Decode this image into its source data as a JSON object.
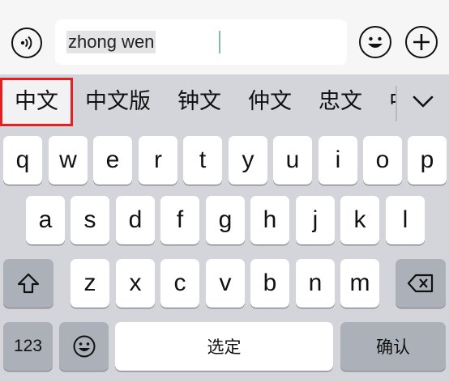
{
  "input": {
    "text": "zhong wen"
  },
  "candidates": [
    {
      "text": "中文",
      "selected": true
    },
    {
      "text": "中文版"
    },
    {
      "text": "钟文"
    },
    {
      "text": "仲文"
    },
    {
      "text": "忠文"
    },
    {
      "text": "中"
    }
  ],
  "keyboard": {
    "row1": [
      "q",
      "w",
      "e",
      "r",
      "t",
      "y",
      "u",
      "i",
      "o",
      "p"
    ],
    "row2": [
      "a",
      "s",
      "d",
      "f",
      "g",
      "h",
      "j",
      "k",
      "l"
    ],
    "row3": [
      "z",
      "x",
      "c",
      "v",
      "b",
      "n",
      "m"
    ],
    "numbers_label": "123",
    "space_label": "选定",
    "confirm_label": "确认"
  },
  "icons": {
    "voice": "voice-icon",
    "emoji": "emoji-icon",
    "plus": "plus-icon",
    "expand": "chevron-down-icon",
    "shift": "shift-icon",
    "delete": "delete-icon",
    "emoji_key": "emoji-icon"
  },
  "colors": {
    "keyboard_bg": "#d3d5da",
    "key_bg": "#ffffff",
    "dark_key_bg": "#acb0b8",
    "highlight": "#e62020"
  }
}
